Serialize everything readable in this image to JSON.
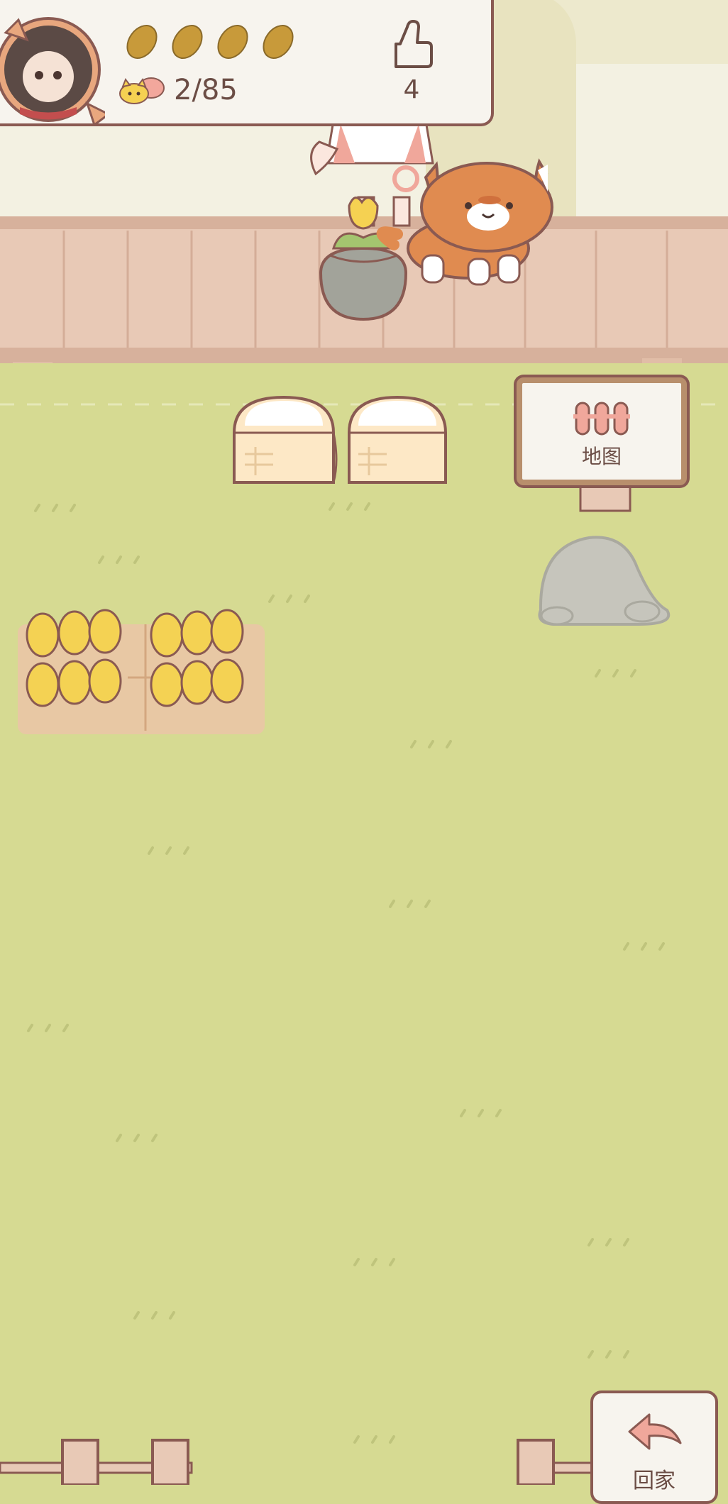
{
  "status": {
    "potato_count": 4,
    "pet_count": "2/85",
    "like_count": "4"
  },
  "sign": {
    "label": "地图"
  },
  "home_button": {
    "label": "回家"
  },
  "colors": {
    "grass": "#d6da92",
    "fence": "#e8c9b6",
    "outline": "#8a5a52",
    "accent_pink": "#f0a79b"
  }
}
